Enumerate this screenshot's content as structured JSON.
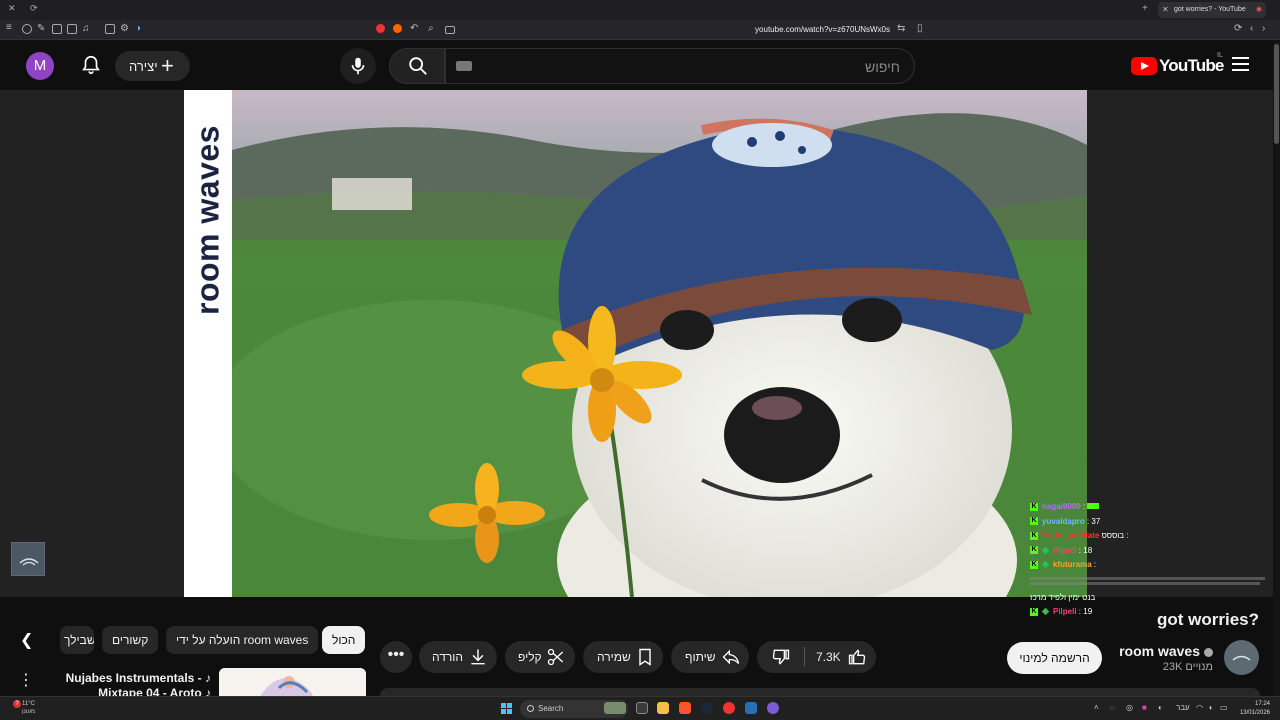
{
  "browser": {
    "tab_title": "got worries? - YouTube",
    "url": "youtube.com/watch?v=z670UNsWx0s"
  },
  "header": {
    "avatar_letter": "M",
    "create_label": "יצירה",
    "search_placeholder": "חיפוש",
    "logo_text": "YouTube",
    "country_code": "IL"
  },
  "video": {
    "brand_text": "room waves",
    "title": "got worries?",
    "channel_name": "room waves",
    "subscribers": "23K מנויים",
    "subscribe_label": "הרשמה למינוי",
    "likes": "7.3K",
    "share_label": "שיתוף",
    "save_label": "שמירה",
    "clip_label": "קליפ",
    "download_label": "הורדה"
  },
  "chat": {
    "messages": [
      {
        "user": "hagai9090",
        "text": ":",
        "color": "#b46bff",
        "badge": "k"
      },
      {
        "user": "yuvaldapro",
        "text": ": 37",
        "color": "#6fb7ff",
        "badge": "k"
      },
      {
        "user": "be_ke_mahlate",
        "text": "בוססס :",
        "color": "#ff3030",
        "badge": "k"
      },
      {
        "user": "Pilpeli",
        "text": ": 18",
        "color": "#ff3e6b",
        "badge": "kd"
      },
      {
        "user": "kfuturama",
        "text": ":",
        "color": "#ffa31a",
        "badge": "kd"
      },
      {
        "user": "",
        "text": "בנט ימין ולפיד מרכז",
        "color": "#ffffff",
        "badge": ""
      },
      {
        "user": "Pilpeli",
        "text": ": 19",
        "color": "#ff3e6b",
        "badge": "kd"
      }
    ]
  },
  "chips": {
    "all": "הכול",
    "uploaded_by": "הועלה על ידי room waves",
    "related": "קשורים",
    "recent": "בשבילך"
  },
  "recommendation": {
    "title_line1": "Nujabes Instrumentals - ♪",
    "title_line2": "Mixtape 04 - Aroto ♪"
  },
  "taskbar": {
    "weather_temp": "11°C",
    "weather_desc": "מעונן",
    "search_label": "Search",
    "time": "17:24",
    "date": "13/01/2026",
    "lang": "עבר"
  }
}
